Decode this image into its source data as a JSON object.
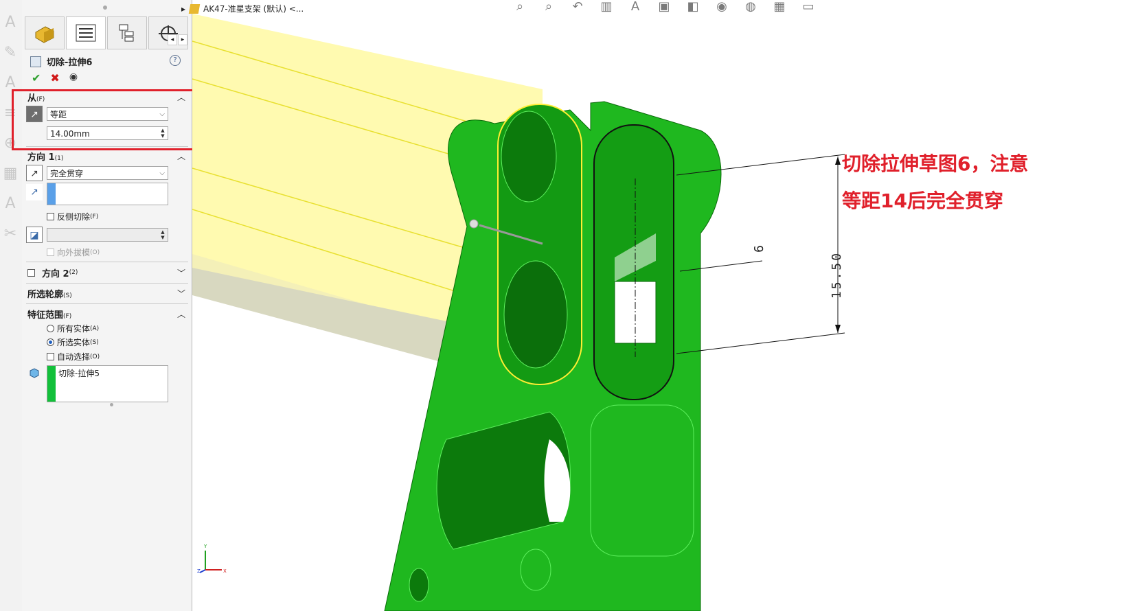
{
  "document": {
    "title": "AK47-准星支架 (默认) <..."
  },
  "property_manager": {
    "feature_name": "切除-拉伸6",
    "help_glyph": "?",
    "tabs": [
      "feature-manager",
      "property-manager",
      "configuration-manager",
      "dimxpert-manager"
    ],
    "tab_scroll": [
      "◂",
      "▸"
    ],
    "from": {
      "label": "从",
      "shortcut": "(F)",
      "condition": "等距",
      "offset_value": "14.00mm"
    },
    "direction1": {
      "label": "方向 1",
      "shortcut": "(1)",
      "end_condition": "完全贯穿",
      "flip_side_label": "反侧切除",
      "flip_side_shortcut": "(F)",
      "draft_outward_label": "向外拔模",
      "draft_outward_shortcut": "(O)"
    },
    "direction2": {
      "label": "方向 2",
      "shortcut": "(2)"
    },
    "selected_contours": {
      "label": "所选轮廓",
      "shortcut": "(S)"
    },
    "feature_scope": {
      "label": "特征范围",
      "shortcut": "(F)",
      "all_bodies": "所有实体",
      "all_bodies_shortcut": "(A)",
      "selected_bodies": "所选实体",
      "selected_bodies_shortcut": "(S)",
      "auto_select": "自动选择",
      "auto_select_shortcut": "(O)",
      "bodies_list": [
        "切除-拉伸5"
      ]
    }
  },
  "annotation": {
    "line1": "切除拉伸草图6，注意",
    "line2": "等距14后完全贯穿"
  },
  "dimensions": {
    "vertical": "15.50",
    "slot_offset": "6"
  },
  "triad": {
    "y": "Y",
    "x": "X",
    "z": "Z"
  },
  "colors": {
    "part_green": "#1fb81f",
    "highlight_yellow": "#fffaa8",
    "red_accent": "#e0202b"
  }
}
